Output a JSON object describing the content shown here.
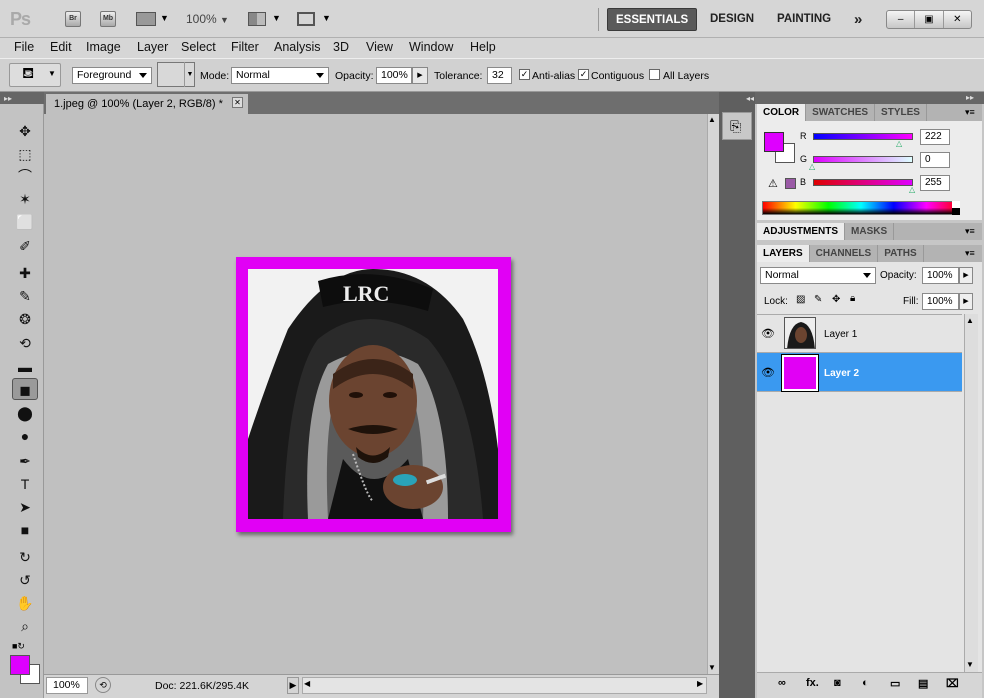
{
  "app": {
    "logo": "Ps",
    "bridge_label": "Br",
    "mini_bridge_label": "Mb",
    "zoom": "100%",
    "workspaces": [
      "ESSENTIALS",
      "DESIGN",
      "PAINTING"
    ],
    "more_label": "»",
    "window_controls": [
      "–",
      "▣",
      "✕"
    ]
  },
  "menu": [
    "File",
    "Edit",
    "Image",
    "Layer",
    "Select",
    "Filter",
    "Analysis",
    "3D",
    "View",
    "Window",
    "Help"
  ],
  "options": {
    "fill_source": "Foreground",
    "mode_label": "Mode:",
    "mode_value": "Normal",
    "opacity_label": "Opacity:",
    "opacity_value": "100%",
    "tolerance_label": "Tolerance:",
    "tolerance_value": "32",
    "antialias_label": "Anti-alias",
    "antialias_checked": true,
    "contiguous_label": "Contiguous",
    "contiguous_checked": true,
    "all_layers_label": "All Layers",
    "all_layers_checked": false
  },
  "tools": [
    "move-tool",
    "marquee-tool",
    "lasso-tool",
    "quick-select-tool",
    "crop-tool",
    "eyedropper-tool",
    "healing-brush-tool",
    "brush-tool",
    "clone-stamp-tool",
    "history-brush-tool",
    "eraser-tool",
    "paint-bucket-tool",
    "blur-tool",
    "dodge-tool",
    "pen-tool",
    "type-tool",
    "path-select-tool",
    "shape-tool",
    "3d-rotate-tool",
    "3d-orbit-tool",
    "hand-tool",
    "zoom-tool"
  ],
  "tool_glyphs": [
    "✥",
    "⬚",
    "⌒",
    "✶",
    "⬜",
    "✐",
    "✚",
    "✎",
    "❂",
    "⟲",
    "▬",
    "◼",
    "⬤",
    "●",
    "✒",
    "T",
    "➤",
    "■",
    "↻",
    "↺",
    "✋",
    "⌕"
  ],
  "document": {
    "tab_title": "1.jpeg @ 100% (Layer 2, RGB/8) *",
    "close": "✕",
    "zoom": "100%",
    "doc_info": "Doc: 221.6K/295.4K",
    "frame_color": "#e100f5"
  },
  "color_panel": {
    "tabs": [
      "COLOR",
      "SWATCHES",
      "STYLES"
    ],
    "channels": [
      {
        "label": "R",
        "value": "222"
      },
      {
        "label": "G",
        "value": "0"
      },
      {
        "label": "B",
        "value": "255"
      }
    ],
    "foreground": "#de00ff",
    "background": "#ffffff"
  },
  "adjust_panel": {
    "tabs": [
      "ADJUSTMENTS",
      "MASKS"
    ]
  },
  "layers_panel": {
    "tabs": [
      "LAYERS",
      "CHANNELS",
      "PATHS"
    ],
    "blend": "Normal",
    "opacity_label": "Opacity:",
    "opacity": "100%",
    "lock_label": "Lock:",
    "fill_label": "Fill:",
    "fill": "100%",
    "layers": [
      {
        "name": "Layer 1",
        "selected": false
      },
      {
        "name": "Layer 2",
        "selected": true
      }
    ],
    "bottom_icons": [
      "link-icon",
      "fx-icon",
      "mask-icon",
      "adjustment-icon",
      "folder-icon",
      "new-layer-icon",
      "trash-icon"
    ],
    "bottom_glyphs": [
      "∞",
      "fx.",
      "◙",
      "◐",
      "▭",
      "▤",
      "⌧"
    ]
  }
}
